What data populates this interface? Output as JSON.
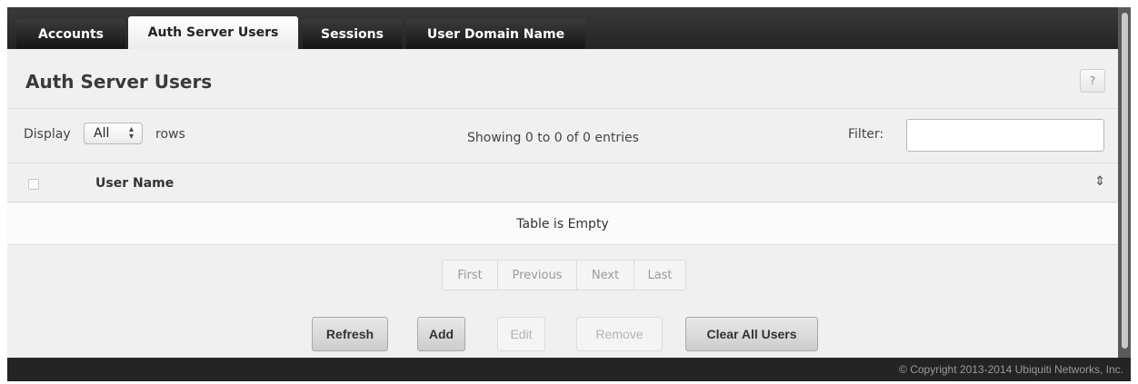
{
  "tabs": [
    {
      "label": "Accounts",
      "active": false
    },
    {
      "label": "Auth Server Users",
      "active": true
    },
    {
      "label": "Sessions",
      "active": false
    },
    {
      "label": "User Domain Name",
      "active": false
    }
  ],
  "panel": {
    "title": "Auth Server Users",
    "help_label": "?"
  },
  "controls": {
    "display_label": "Display",
    "rows_selected": "All",
    "rows_label": "rows",
    "showing_text": "Showing 0 to 0 of 0 entries",
    "filter_label": "Filter:",
    "filter_value": ""
  },
  "table": {
    "columns": [
      "User Name"
    ],
    "empty_message": "Table is Empty"
  },
  "pagination": {
    "first": "First",
    "previous": "Previous",
    "next": "Next",
    "last": "Last"
  },
  "actions": {
    "refresh": "Refresh",
    "add": "Add",
    "edit": "Edit",
    "remove": "Remove",
    "clear_all": "Clear All Users"
  },
  "footer": {
    "copyright": "© Copyright 2013-2014 Ubiquiti Networks, Inc."
  },
  "icons": {
    "sort": "sort-icon",
    "select_arrows": "select-arrows-icon",
    "help": "help-icon"
  }
}
